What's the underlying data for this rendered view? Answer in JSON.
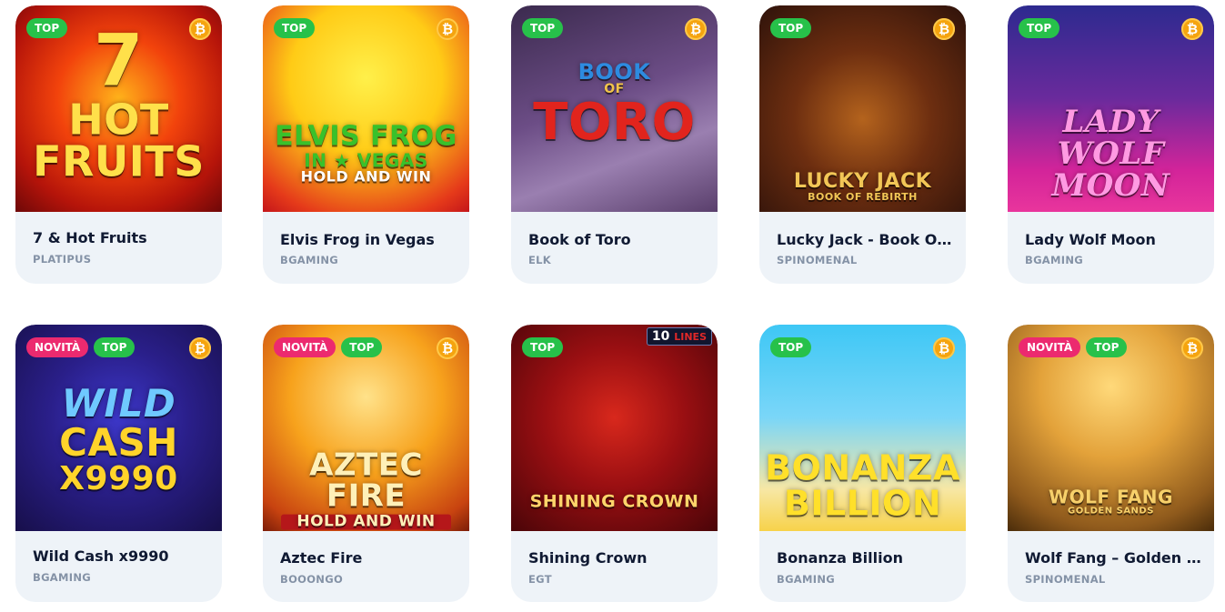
{
  "games": [
    {
      "title": "7 & Hot Fruits",
      "provider": "PLATIPUS",
      "badges": [
        "TOP"
      ],
      "art": [
        "7",
        "HOT",
        "FRUITS"
      ],
      "bg": "radial-gradient(circle at 50% 45%, #ffb21a 0%, #f2430c 40%, #b5140a 75%, #6e0808 100%)",
      "art_color": "#ffe04a"
    },
    {
      "title": "Elvis Frog in Vegas",
      "provider": "BGAMING",
      "badges": [
        "TOP"
      ],
      "art": [
        "ELVIS FROG",
        "IN ★ VEGAS",
        "HOLD AND WIN"
      ],
      "bg": "radial-gradient(circle at 50% 35%, #fff04a 0%, #ffcb16 45%, #e53a1a 85%, #c4161a 100%)",
      "art_color": "#39c12b"
    },
    {
      "title": "Book of Toro",
      "provider": "ELK",
      "badges": [
        "TOP"
      ],
      "art": [
        "BOOK",
        "OF",
        "TORO"
      ],
      "bg": "linear-gradient(160deg, #3b2a4e 0%, #6c4d86 45%, #9a7fb0 70%, #5a3f6c 100%)",
      "art_color": "#e1241d"
    },
    {
      "title": "Lucky Jack - Book Of Rebirth",
      "provider": "SPINOMENAL",
      "badges": [
        "TOP"
      ],
      "art": [
        "",
        "LUCKY JACK",
        "BOOK OF REBIRTH"
      ],
      "bg": "radial-gradient(circle at 50% 55%, #b4631d 0%, #6d2e10 45%, #2e120a 100%)",
      "art_color": "#f2c656"
    },
    {
      "title": "Lady Wolf Moon",
      "provider": "BGAMING",
      "badges": [
        "TOP"
      ],
      "art": [
        "",
        "LADY WOLF",
        "MOON"
      ],
      "bg": "linear-gradient(180deg, #2d2a8f 0%, #6a2a9c 45%, #d3249a 80%, #e9359c 100%)",
      "art_color": "#ff9ae2"
    },
    {
      "title": "Wild Cash x9990",
      "provider": "BGAMING",
      "badges": [
        "NOVITÀ",
        "TOP"
      ],
      "art": [
        "WILD",
        "CASH",
        "X9990"
      ],
      "bg": "radial-gradient(circle at 50% 45%, #3c37c9 0%, #2a1f8a 45%, #170f4a 100%)",
      "art_color": "#ffd42a"
    },
    {
      "title": "Aztec Fire",
      "provider": "BOOONGO",
      "badges": [
        "NOVITÀ",
        "TOP"
      ],
      "art": [
        "",
        "AZTEC FIRE",
        "HOLD AND WIN"
      ],
      "bg": "radial-gradient(circle at 50% 35%, #ffe28a 0%, #f7a21c 45%, #c84310 85%, #7c1d08 100%)",
      "art_color": "#fff0b8"
    },
    {
      "title": "Shining Crown",
      "provider": "EGT",
      "badges": [
        "TOP"
      ],
      "art": [
        "",
        "",
        "SHINING CROWN"
      ],
      "lines_tag": "10",
      "lines_word": "LINES",
      "bg": "radial-gradient(circle at 50% 45%, #d8281c 0%, #9a0f12 45%, #4a0508 100%)",
      "art_color": "#ffd46a"
    },
    {
      "title": "Bonanza Billion",
      "provider": "BGAMING",
      "badges": [
        "TOP"
      ],
      "art": [
        "",
        "BONANZA",
        "BILLION"
      ],
      "bg": "linear-gradient(180deg, #3ec7f5 0%, #7ad6f8 45%, #f7e7a4 80%, #f7d24a 100%)",
      "art_color": "#ffe02a"
    },
    {
      "title": "Wolf Fang – Golden Sands",
      "provider": "SPINOMENAL",
      "badges": [
        "NOVITÀ",
        "TOP"
      ],
      "art": [
        "",
        "WOLF FANG",
        "GOLDEN SANDS"
      ],
      "bg": "radial-gradient(circle at 50% 30%, #ffd97a 0%, #e3a23a 40%, #8f5a1c 80%, #4a2c0a 100%)",
      "art_color": "#f7d06a"
    }
  ],
  "coin_symbol": "₿"
}
